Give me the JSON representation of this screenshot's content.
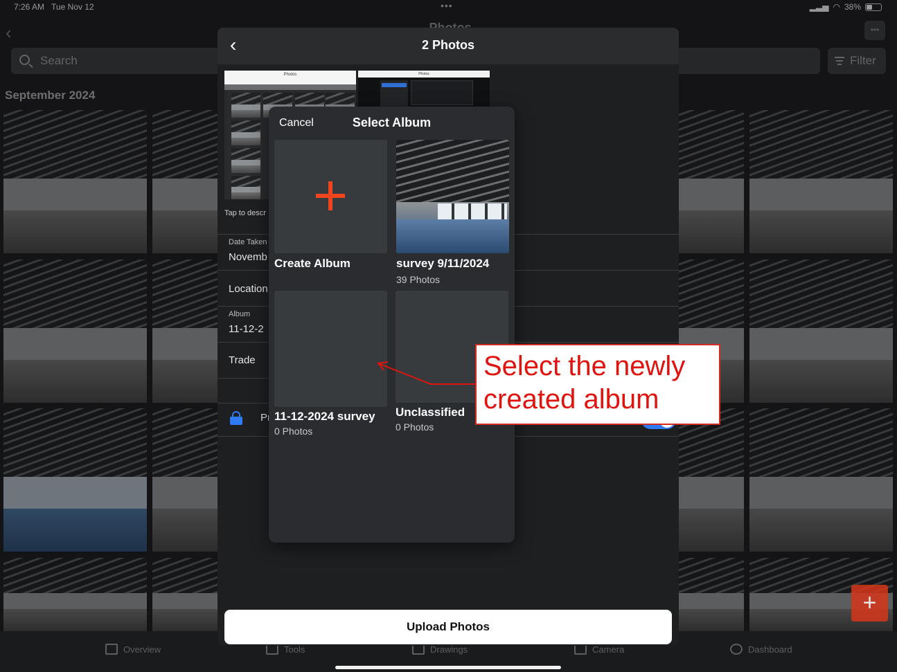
{
  "status_bar": {
    "time": "7:26 AM",
    "date": "Tue Nov 12",
    "battery": "38%"
  },
  "background": {
    "title": "Photos",
    "search_placeholder": "Search",
    "filter_label": "Filter",
    "section_label": "September 2024"
  },
  "tab_bar": {
    "items": [
      "Overview",
      "Tools",
      "Drawings",
      "Camera",
      "Dashboard"
    ]
  },
  "panel": {
    "title": "2 Photos",
    "tap_hint": "Tap to descr",
    "date_taken_label": "Date Taken",
    "date_taken_value": "Novemb",
    "location_label": "Location",
    "album_label": "Album",
    "album_value": "11-12-2",
    "trade_label": "Trade",
    "private_label": "Pr",
    "upload_button": "Upload Photos",
    "thumb1_title": "Photos",
    "thumb2_title": "Photos"
  },
  "popover": {
    "cancel": "Cancel",
    "title": "Select Album",
    "albums": [
      {
        "name": "Create Album",
        "count": ""
      },
      {
        "name": "survey 9/11/2024",
        "count": "39 Photos"
      },
      {
        "name": "11-12-2024 survey",
        "count": "0 Photos"
      },
      {
        "name": "Unclassified",
        "count": "0 Photos"
      }
    ]
  },
  "annotation": {
    "line1": "Select the newly",
    "line2": "created album",
    "color": "#e0130e"
  },
  "colors": {
    "accent": "#f0451e",
    "toggle": "#2f7bf5",
    "fab": "#d6361a"
  }
}
